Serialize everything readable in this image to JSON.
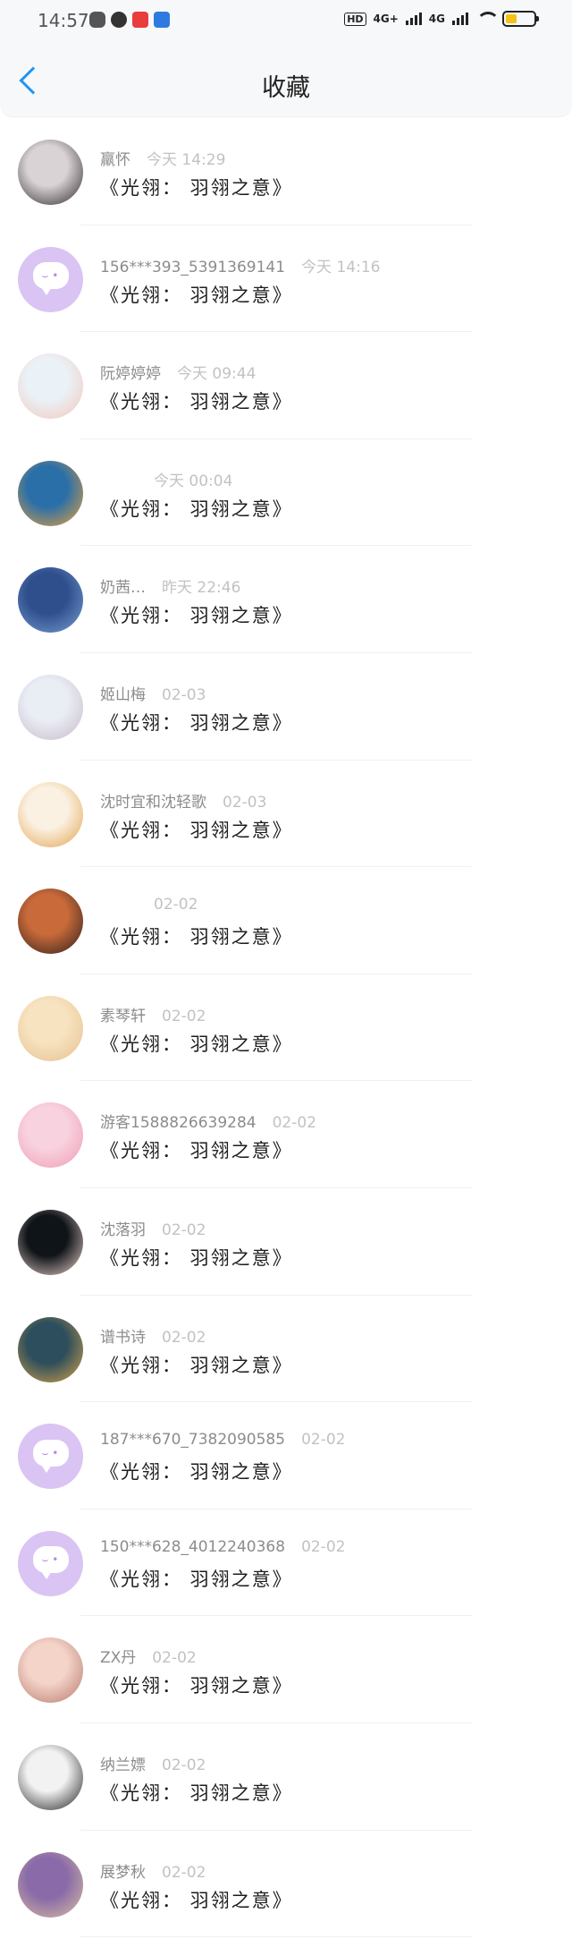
{
  "status_bar": {
    "time": "14:57",
    "network_1": "4G+",
    "network_2": "4G",
    "hd_label": "HD",
    "battery_level": 0.4,
    "icons": [
      "game-controller-icon",
      "k-app-icon",
      "red-app-icon",
      "blue-app-icon"
    ]
  },
  "header": {
    "title": "收藏",
    "back_icon": "chevron-left-icon",
    "accent_color": "#2196f3"
  },
  "items": [
    {
      "nickname": "羸怀",
      "time": "今天 14:29",
      "book": "《光翎： 羽翎之意》",
      "avatar": {
        "colors": [
          "#d9d3d6",
          "#2a2528"
        ],
        "kind": "photo"
      }
    },
    {
      "nickname": "156***393_5391369141",
      "time": "今天 14:16",
      "book": "《光翎： 羽翎之意》",
      "avatar": {
        "colors": [
          "#d9c4f4",
          "#d9c4f4"
        ],
        "kind": "default"
      }
    },
    {
      "nickname": "阮婷婷婷",
      "time": "今天 09:44",
      "book": "《光翎： 羽翎之意》",
      "avatar": {
        "colors": [
          "#eaf2f8",
          "#f2c6b8"
        ],
        "kind": "photo"
      }
    },
    {
      "nickname": "",
      "time": "今天 00:04",
      "book": "《光翎： 羽翎之意》",
      "avatar": {
        "colors": [
          "#2a6fa8",
          "#f0a23a"
        ],
        "kind": "photo"
      }
    },
    {
      "nickname": "奶茜…",
      "time": "昨天 22:46",
      "book": "《光翎： 羽翎之意》",
      "avatar": {
        "colors": [
          "#2e4e8c",
          "#7aa0d4"
        ],
        "kind": "photo"
      }
    },
    {
      "nickname": "姬山梅",
      "time": "02-03",
      "book": "《光翎： 羽翎之意》",
      "avatar": {
        "colors": [
          "#e9eef5",
          "#c9b8c8"
        ],
        "kind": "photo"
      }
    },
    {
      "nickname": "沈时宜和沈轻歌",
      "time": "02-03",
      "book": "《光翎： 羽翎之意》",
      "avatar": {
        "colors": [
          "#fbf1e3",
          "#e2a24c"
        ],
        "kind": "photo"
      }
    },
    {
      "nickname": "",
      "time": "02-02",
      "book": "《光翎： 羽翎之意》",
      "avatar": {
        "colors": [
          "#c96a3a",
          "#2a1d1a"
        ],
        "kind": "photo"
      }
    },
    {
      "nickname": "素琴轩",
      "time": "02-02",
      "book": "《光翎： 羽翎之意》",
      "avatar": {
        "colors": [
          "#f7e3c0",
          "#e7bf8f"
        ],
        "kind": "photo"
      }
    },
    {
      "nickname": "游客1588826639284",
      "time": "02-02",
      "book": "《光翎： 羽翎之意》",
      "avatar": {
        "colors": [
          "#f8d3df",
          "#ef9ab4"
        ],
        "kind": "photo"
      }
    },
    {
      "nickname": "沈落羽",
      "time": "02-02",
      "book": "《光翎： 羽翎之意》",
      "avatar": {
        "colors": [
          "#0f1418",
          "#f0d6cf"
        ],
        "kind": "photo"
      }
    },
    {
      "nickname": "谱书诗",
      "time": "02-02",
      "book": "《光翎： 羽翎之意》",
      "avatar": {
        "colors": [
          "#2d4e5c",
          "#d9a54a"
        ],
        "kind": "photo"
      }
    },
    {
      "nickname": "187***670_7382090585",
      "time": "02-02",
      "book": "《光翎： 羽翎之意》",
      "avatar": {
        "colors": [
          "#d9c4f4",
          "#d9c4f4"
        ],
        "kind": "default"
      }
    },
    {
      "nickname": "150***628_4012240368",
      "time": "02-02",
      "book": "《光翎： 羽翎之意》",
      "avatar": {
        "colors": [
          "#d9c4f4",
          "#d9c4f4"
        ],
        "kind": "default"
      }
    },
    {
      "nickname": "ZX丹",
      "time": "02-02",
      "book": "《光翎： 羽翎之意》",
      "avatar": {
        "colors": [
          "#f4d3c9",
          "#b5786a"
        ],
        "kind": "photo"
      }
    },
    {
      "nickname": "纳兰嫖",
      "time": "02-02",
      "book": "《光翎： 羽翎之意》",
      "avatar": {
        "colors": [
          "#f2f2f2",
          "#1a1a1a"
        ],
        "kind": "photo"
      }
    },
    {
      "nickname": "展梦秋",
      "time": "02-02",
      "book": "《光翎： 羽翎之意》",
      "avatar": {
        "colors": [
          "#8a6aa8",
          "#d8c2a0"
        ],
        "kind": "photo"
      }
    }
  ]
}
